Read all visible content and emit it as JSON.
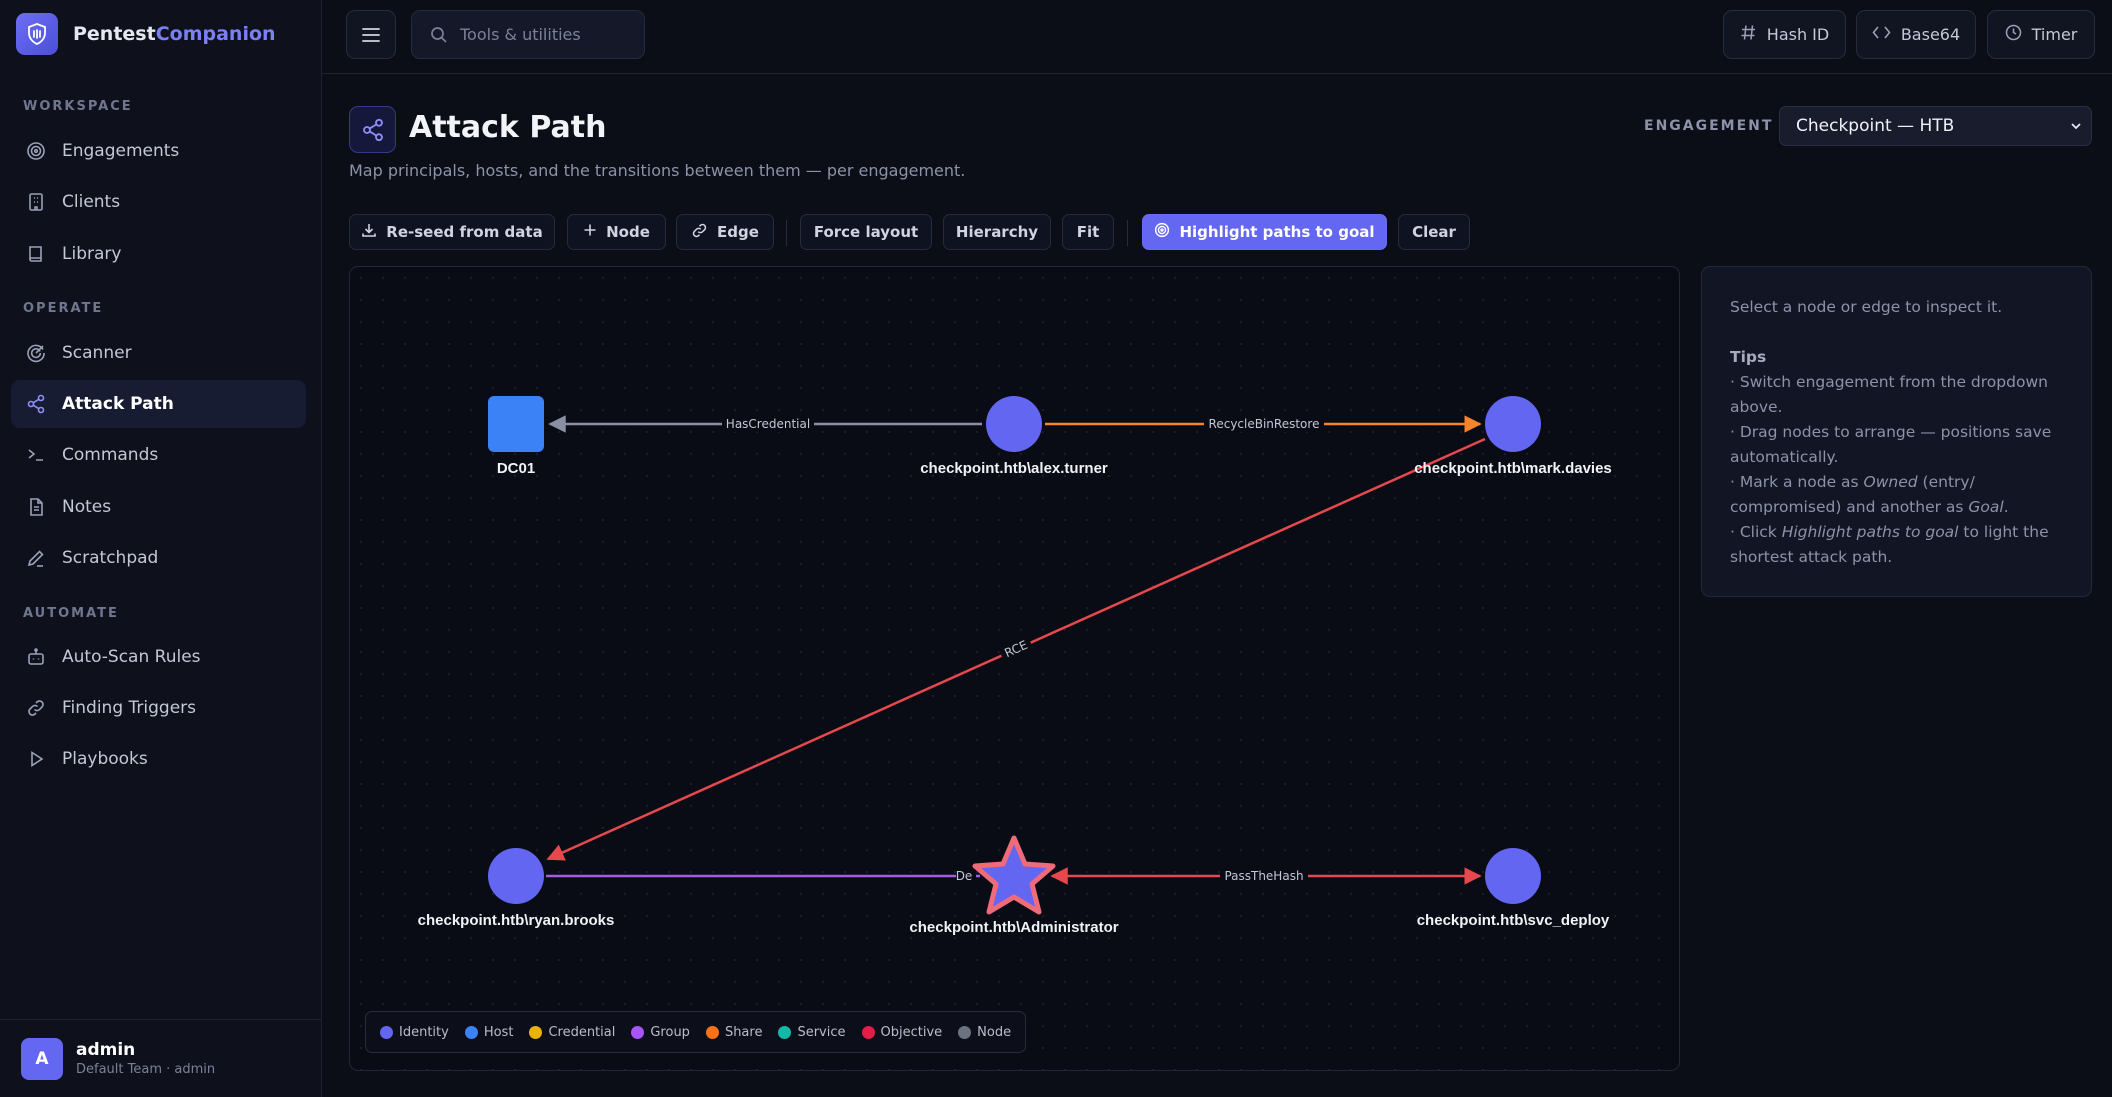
{
  "brand": {
    "name_part1": "Pentest",
    "name_part2": "Companion"
  },
  "sidebar": {
    "sections": [
      {
        "label": "WORKSPACE"
      },
      {
        "label": "OPERATE"
      },
      {
        "label": "AUTOMATE"
      }
    ],
    "items": [
      {
        "label": "Engagements",
        "icon": "target-icon"
      },
      {
        "label": "Clients",
        "icon": "building-icon"
      },
      {
        "label": "Library",
        "icon": "book-icon"
      },
      {
        "label": "Scanner",
        "icon": "radar-icon"
      },
      {
        "label": "Attack Path",
        "icon": "share-icon",
        "active": true
      },
      {
        "label": "Commands",
        "icon": "terminal-icon"
      },
      {
        "label": "Notes",
        "icon": "file-icon"
      },
      {
        "label": "Scratchpad",
        "icon": "pencil-icon"
      },
      {
        "label": "Auto-Scan Rules",
        "icon": "robot-icon"
      },
      {
        "label": "Finding Triggers",
        "icon": "link-icon"
      },
      {
        "label": "Playbooks",
        "icon": "play-icon"
      }
    ]
  },
  "user": {
    "initial": "A",
    "name": "admin",
    "subtitle": "Default Team · admin"
  },
  "topbar": {
    "search_placeholder": "Tools & utilities",
    "tools": [
      {
        "label": "Hash ID",
        "icon": "hash-icon"
      },
      {
        "label": "Base64",
        "icon": "code-icon"
      },
      {
        "label": "Timer",
        "icon": "clock-icon"
      }
    ]
  },
  "header": {
    "title": "Attack Path",
    "subtitle": "Map principals, hosts, and the transitions between them — per engagement.",
    "engagement_label": "ENGAGEMENT",
    "engagement_value": "Checkpoint — HTB"
  },
  "toolbar": {
    "reseed": "Re-seed from data",
    "node": "Node",
    "edge": "Edge",
    "force_layout": "Force layout",
    "hierarchy": "Hierarchy",
    "fit": "Fit",
    "highlight": "Highlight paths to goal",
    "clear": "Clear"
  },
  "graph": {
    "nodes": [
      {
        "id": "dc01",
        "label": "DC01",
        "type": "Host",
        "shape": "square"
      },
      {
        "id": "alex",
        "label": "checkpoint.htb\\alex.turner",
        "type": "Identity",
        "shape": "circle"
      },
      {
        "id": "mark",
        "label": "checkpoint.htb\\mark.davies",
        "type": "Identity",
        "shape": "circle"
      },
      {
        "id": "ryan",
        "label": "checkpoint.htb\\ryan.brooks",
        "type": "Identity",
        "shape": "circle"
      },
      {
        "id": "admin",
        "label": "checkpoint.htb\\Administrator",
        "type": "Identity",
        "shape": "star",
        "goal": true
      },
      {
        "id": "svc",
        "label": "checkpoint.htb\\svc_deploy",
        "type": "Identity",
        "shape": "circle"
      }
    ],
    "edges": [
      {
        "from": "alex",
        "to": "dc01",
        "label": "HasCredential",
        "color": "#8b8fa3"
      },
      {
        "from": "alex",
        "to": "mark",
        "label": "RecycleBinRestore",
        "color": "#f5842a"
      },
      {
        "from": "mark",
        "to": "ryan",
        "label": "RCE",
        "color": "#e5484d"
      },
      {
        "from": "ryan",
        "to": "admin",
        "label": "De",
        "color": "#a45ce6"
      },
      {
        "from": "admin",
        "to": "svc",
        "label": "PassTheHash",
        "color": "#e5484d"
      }
    ]
  },
  "legend": [
    {
      "label": "Identity",
      "color": "#6366f1"
    },
    {
      "label": "Host",
      "color": "#3b82f6"
    },
    {
      "label": "Credential",
      "color": "#eab308"
    },
    {
      "label": "Group",
      "color": "#a855f7"
    },
    {
      "label": "Share",
      "color": "#f97316"
    },
    {
      "label": "Service",
      "color": "#14b8a6"
    },
    {
      "label": "Objective",
      "color": "#e11d48"
    },
    {
      "label": "Node",
      "color": "#6b7280"
    }
  ],
  "inspector": {
    "empty": "Select a node or edge to inspect it.",
    "tips_title": "Tips",
    "tip1": "· Switch engagement from the dropdown above.",
    "tip2": "· Drag nodes to arrange — positions save automatically.",
    "tip3_a": "· Mark a node as ",
    "tip3_b": "Owned",
    "tip3_c": " (entry/ compromised) and another as ",
    "tip3_d": "Goal",
    "tip3_e": ".",
    "tip4_a": "· Click ",
    "tip4_b": "Highlight paths to goal",
    "tip4_c": " to light the shortest attack path."
  }
}
